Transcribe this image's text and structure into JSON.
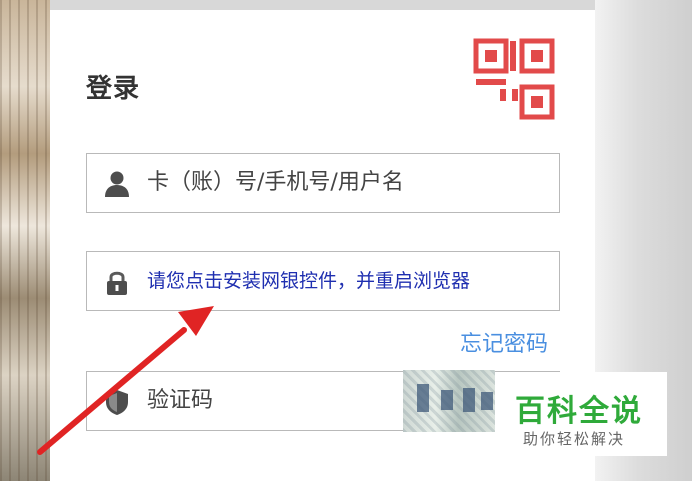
{
  "login": {
    "title": "登录",
    "username_placeholder": "卡（账）号/手机号/用户名",
    "password_notice": "请您点击安装网银控件，并重启浏览器",
    "forgot_password": "忘记密码",
    "captcha_placeholder": "验证码"
  },
  "watermark": {
    "brand": "百科全说",
    "slogan": "助你轻松解决"
  },
  "icons": {
    "user": "user-icon",
    "lock": "lock-icon",
    "shield": "shield-icon",
    "qr": "qr-code-icon"
  },
  "colors": {
    "notice_text": "#1f2fb0",
    "link": "#4a8fe0",
    "qr": "#e24a4a",
    "arrow": "#e02424",
    "brand": "#2faa3a"
  }
}
